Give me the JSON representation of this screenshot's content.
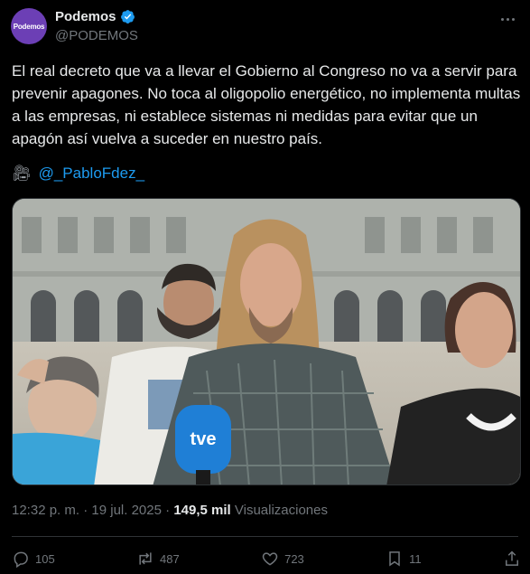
{
  "author": {
    "name": "Podemos",
    "handle": "@PODEMOS",
    "avatar_text": "Podemos",
    "verified_color": "#1d9bf0",
    "avatar_color": "#6c3fb5"
  },
  "tweet": {
    "text": "El real decreto que va a llevar el Gobierno al Congreso no va a servir para prevenir apagones. No toca al oligopolio energético, no implementa multas a las empresas, ni establece sistemas ni medidas para evitar que un apagón así vuelva a suceder en nuestro país.",
    "credit_icon": "movie-camera-icon",
    "credit_mention": "@_PabloFdez_"
  },
  "media": {
    "microphone_label": "tve"
  },
  "meta": {
    "time": "12:32 p. m.",
    "separator": " · ",
    "date": "19 jul. 2025",
    "views_count": "149,5 mil",
    "views_label": "Visualizaciones"
  },
  "actions": {
    "replies": "105",
    "reposts": "487",
    "likes": "723",
    "bookmarks": "11"
  }
}
